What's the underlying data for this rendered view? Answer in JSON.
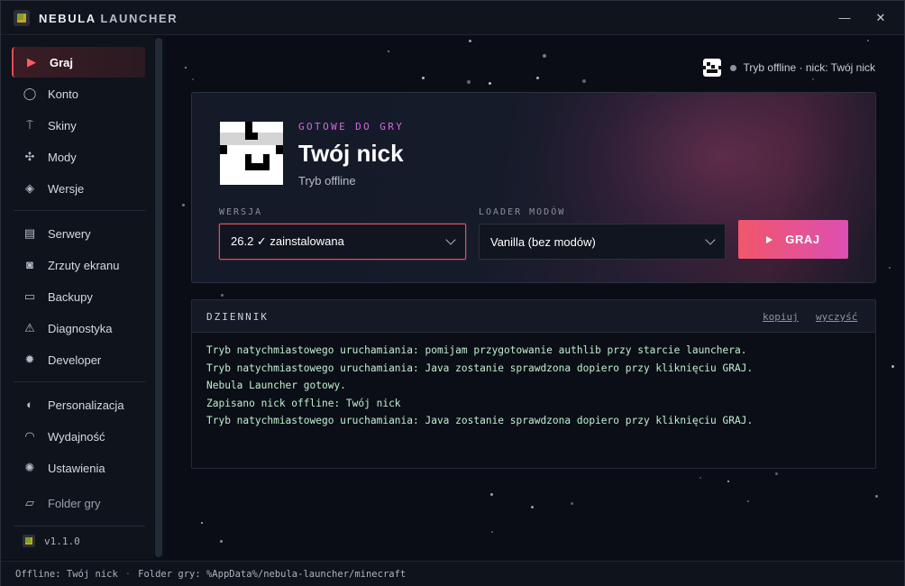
{
  "titlebar": {
    "brand_bold": "NEBULA",
    "brand_light": "LAUNCHER",
    "min_glyph": "—",
    "close_glyph": "✕"
  },
  "sidebar": {
    "items": [
      {
        "label": "Graj",
        "icon": "play-icon",
        "glyph": "▶",
        "active": true
      },
      {
        "label": "Konto",
        "icon": "user-icon",
        "glyph": "◯"
      },
      {
        "label": "Skiny",
        "icon": "shirt-icon",
        "glyph": "⍑"
      },
      {
        "label": "Mody",
        "icon": "puzzle-icon",
        "glyph": "✣"
      },
      {
        "label": "Wersje",
        "icon": "layers-icon",
        "glyph": "◈"
      },
      {
        "label": "Serwery",
        "icon": "server-icon",
        "glyph": "▤"
      },
      {
        "label": "Zrzuty ekranu",
        "icon": "camera-icon",
        "glyph": "◙"
      },
      {
        "label": "Backupy",
        "icon": "archive-icon",
        "glyph": "▭"
      },
      {
        "label": "Diagnostyka",
        "icon": "warning-icon",
        "glyph": "⚠"
      },
      {
        "label": "Developer",
        "icon": "bug-icon",
        "glyph": "✹"
      },
      {
        "label": "Personalizacja",
        "icon": "palette-icon",
        "glyph": "◐"
      },
      {
        "label": "Wydajność",
        "icon": "gauge-icon",
        "glyph": "◠"
      },
      {
        "label": "Ustawienia",
        "icon": "gear-icon",
        "glyph": "✺"
      },
      {
        "label": "Folder gry",
        "icon": "folder-icon",
        "glyph": "▱"
      }
    ],
    "version": "v1.1.0"
  },
  "main": {
    "status_text": "Tryb offline · nick: Twój nick",
    "hero": {
      "eyebrow": "GOTOWE DO GRY",
      "title": "Twój nick",
      "subtitle": "Tryb offline",
      "version_label": "WERSJA",
      "version_value": "26.2 ✓ zainstalowana",
      "loader_label": "LOADER MODÓW",
      "loader_value": "Vanilla (bez modów)",
      "play_label": "GRAJ",
      "accent_from": "#f1566a",
      "accent_to": "#dd4fb3"
    },
    "log": {
      "title": "DZIENNIK",
      "copy_label": "kopiuj",
      "clear_label": "wyczyść",
      "lines": [
        "Tryb natychmiastowego uruchamiania: pomijam przygotowanie authlib przy starcie launchera.",
        "Tryb natychmiastowego uruchamiania: Java zostanie sprawdzona dopiero przy kliknięciu GRAJ.",
        "Nebula Launcher gotowy.",
        "Zapisano nick offline: Twój nick",
        "Tryb natychmiastowego uruchamiania: Java zostanie sprawdzona dopiero przy kliknięciu GRAJ."
      ]
    }
  },
  "statusbar": {
    "offline": "Offline: Twój nick",
    "separator": "·",
    "folder": "Folder gry: %AppData%/nebula-launcher/minecraft"
  }
}
